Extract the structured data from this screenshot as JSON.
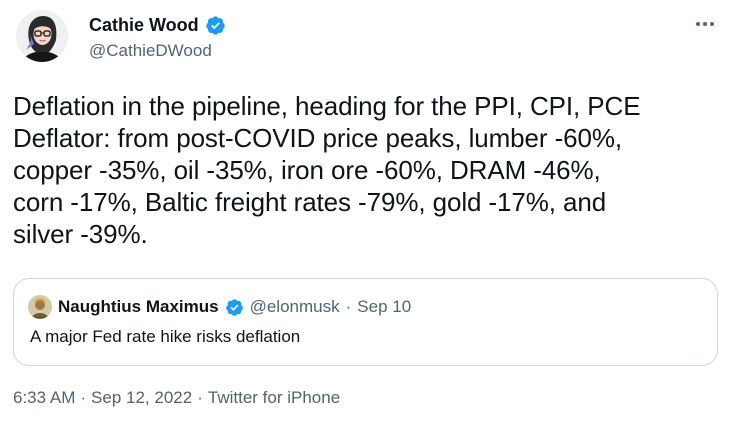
{
  "author": {
    "display_name": "Cathie Wood",
    "handle": "@CathieDWood"
  },
  "tweet": {
    "text": "Deflation in the pipeline, heading for the PPI, CPI, PCE\nDeflator: from post-COVID price peaks, lumber -60%,\ncopper -35%, oil -35%, iron ore -60%, DRAM -46%,\ncorn -17%, Baltic freight rates -79%, gold -17%, and\nsilver -39%."
  },
  "quoted_tweet": {
    "display_name": "Naughtius Maximus",
    "handle": "@elonmusk",
    "separator": "·",
    "date": "Sep 10",
    "text": "A major Fed rate hike risks deflation"
  },
  "meta": {
    "time": "6:33 AM",
    "separator1": "·",
    "date": "Sep 12, 2022",
    "separator2": "·",
    "source": "Twitter for iPhone"
  },
  "icons": {
    "verified": "verified-badge-icon",
    "more": "more-horizontal-icon"
  },
  "colors": {
    "text_primary": "#0f1419",
    "text_secondary": "#536471",
    "verified_blue": "#1d9bf0",
    "border": "#cfd9de"
  }
}
